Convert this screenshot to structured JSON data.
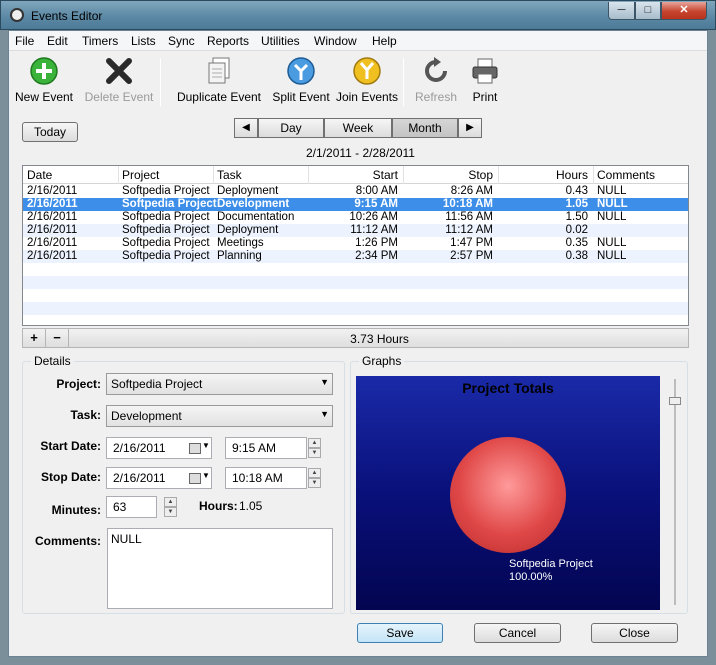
{
  "window": {
    "title": "Events Editor",
    "controls": {
      "minimize": "─",
      "maximize": "□",
      "close": "✕"
    }
  },
  "menu": [
    "File",
    "Edit",
    "Timers",
    "Lists",
    "Sync",
    "Reports",
    "Utilities",
    "Window",
    "Help"
  ],
  "toolbar": {
    "new_event": "New Event",
    "delete_event": "Delete Event",
    "duplicate_event": "Duplicate Event",
    "split_event": "Split Event",
    "join_events": "Join Events",
    "refresh": "Refresh",
    "print": "Print"
  },
  "nav": {
    "today": "Today",
    "prev": "◀",
    "next": "▶",
    "views": [
      "Day",
      "Week",
      "Month"
    ],
    "selected_view": "Month",
    "date_range": "2/1/2011 - 2/28/2011"
  },
  "table": {
    "columns": [
      "Date",
      "Project",
      "Task",
      "Start",
      "Stop",
      "Hours",
      "Comments"
    ],
    "rows": [
      {
        "date": "2/16/2011",
        "project": "Softpedia Project",
        "task": "Deployment",
        "start": "8:00 AM",
        "stop": "8:26 AM",
        "hours": "0.43",
        "comments": "NULL"
      },
      {
        "date": "2/16/2011",
        "project": "Softpedia Project",
        "task": "Development",
        "start": "9:15 AM",
        "stop": "10:18 AM",
        "hours": "1.05",
        "comments": "NULL"
      },
      {
        "date": "2/16/2011",
        "project": "Softpedia Project",
        "task": "Documentation",
        "start": "10:26 AM",
        "stop": "11:56 AM",
        "hours": "1.50",
        "comments": "NULL"
      },
      {
        "date": "2/16/2011",
        "project": "Softpedia Project",
        "task": "Deployment",
        "start": "11:12 AM",
        "stop": "11:12 AM",
        "hours": "0.02",
        "comments": ""
      },
      {
        "date": "2/16/2011",
        "project": "Softpedia Project",
        "task": "Meetings",
        "start": "1:26 PM",
        "stop": "1:47 PM",
        "hours": "0.35",
        "comments": "NULL"
      },
      {
        "date": "2/16/2011",
        "project": "Softpedia Project",
        "task": "Planning",
        "start": "2:34 PM",
        "stop": "2:57 PM",
        "hours": "0.38",
        "comments": "NULL"
      }
    ],
    "selected_row": 1,
    "add": "+",
    "remove": "−",
    "total": "3.73 Hours"
  },
  "details": {
    "title": "Details",
    "project_label": "Project:",
    "project_value": "Softpedia Project",
    "task_label": "Task:",
    "task_value": "Development",
    "start_date_label": "Start Date:",
    "start_date": "2/16/2011",
    "start_time": "9:15 AM",
    "stop_date_label": "Stop Date:",
    "stop_date": "2/16/2011",
    "stop_time": "10:18 AM",
    "minutes_label": "Minutes:",
    "minutes": "63",
    "hours_label": "Hours:",
    "hours": "1.05",
    "comments_label": "Comments:",
    "comments": "NULL"
  },
  "graphs": {
    "title": "Graphs",
    "chart_title": "Project Totals",
    "slice_label": "Softpedia Project",
    "slice_pct": "100.00%"
  },
  "chart_data": {
    "type": "pie",
    "title": "Project Totals",
    "categories": [
      "Softpedia Project"
    ],
    "values": [
      100.0
    ]
  },
  "actions": {
    "save": "Save",
    "cancel": "Cancel",
    "close": "Close"
  },
  "colors": {
    "selection": "#3d8ee9",
    "pie": "#e04848",
    "chart_bg": "#09107a",
    "new_icon": "#3bb33b"
  }
}
